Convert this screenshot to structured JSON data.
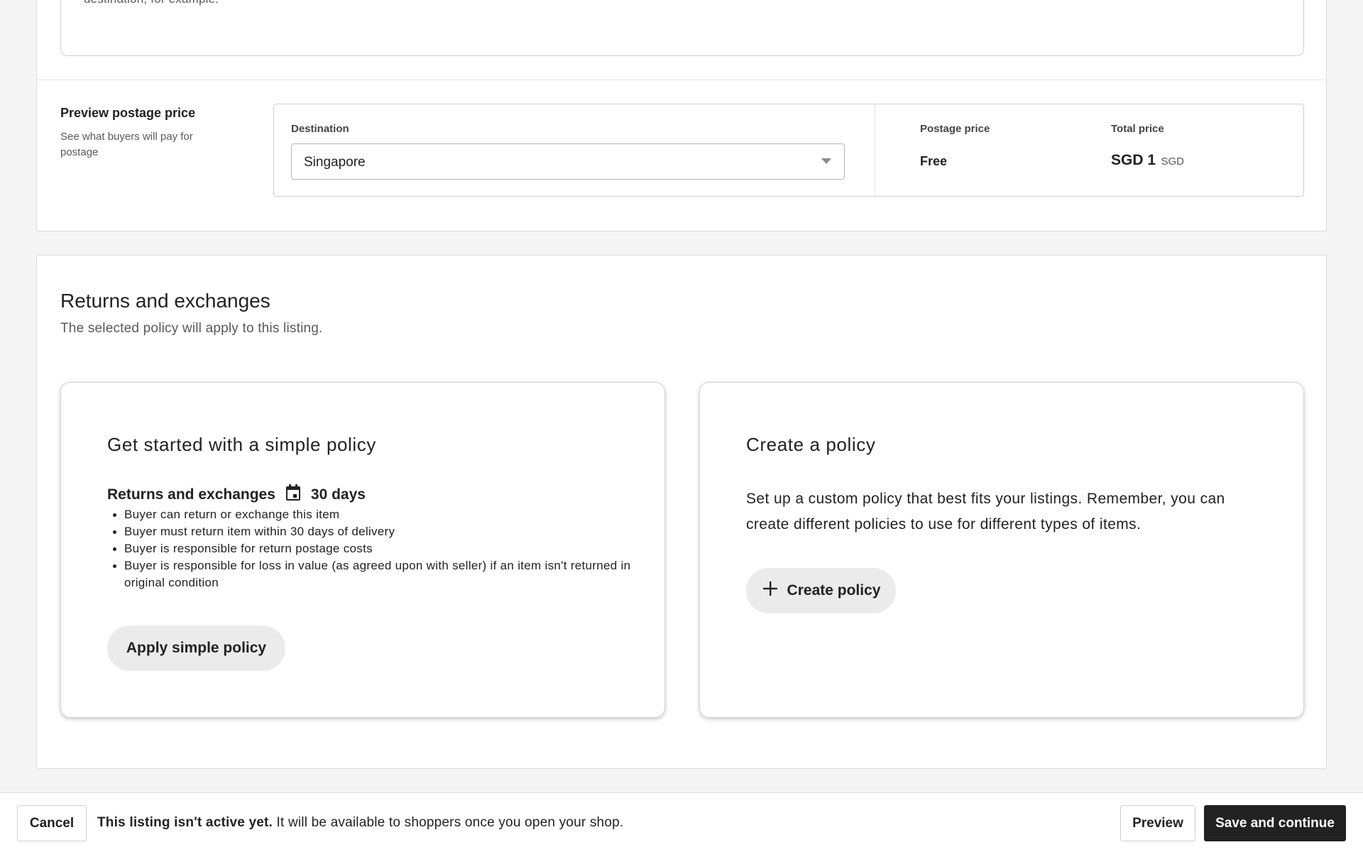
{
  "shipping": {
    "previous_note_text": "destination, for example.",
    "preview": {
      "title": "Preview postage price",
      "subtitle": "See what buyers will pay for postage",
      "destination_label": "Destination",
      "destination_value": "Singapore",
      "postage_label": "Postage price",
      "postage_value": "Free",
      "total_label": "Total price",
      "total_amount": "SGD 1",
      "total_currency": "SGD"
    }
  },
  "returns": {
    "title": "Returns and exchanges",
    "subtitle": "The selected policy will apply to this listing.",
    "simple_card": {
      "title": "Get started with a simple policy",
      "policy_label": "Returns and exchanges",
      "calendar_icon": "calendar-icon",
      "days": "30 days",
      "bullets": [
        "Buyer can return or exchange this item",
        "Buyer must return item within 30 days of delivery",
        "Buyer is responsible for return postage costs",
        "Buyer is responsible for loss in value (as agreed upon with seller) if an item isn't returned in original condition"
      ],
      "button_label": "Apply simple policy"
    },
    "custom_card": {
      "title": "Create a policy",
      "description": "Set up a custom policy that best fits your listings. Remember, you can create different policies to use for different types of items.",
      "button_icon": "plus-icon",
      "button_label": "Create policy"
    }
  },
  "footer": {
    "cancel_label": "Cancel",
    "status_strong": "This listing isn't active yet.",
    "status_text": "It will be available to shoppers once you open your shop.",
    "preview_label": "Preview",
    "save_label": "Save and continue"
  },
  "colors": {
    "background": "#f5f5f5",
    "panel": "#ffffff",
    "text": "#222222",
    "muted_text": "#595959",
    "pill_button": "#ebebeb",
    "primary_button": "#222222"
  }
}
